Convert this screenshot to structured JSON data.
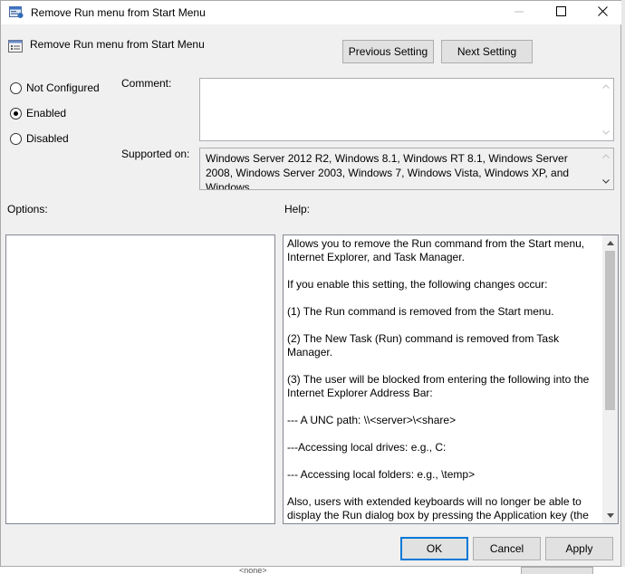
{
  "window": {
    "title": "Remove Run menu from Start Menu"
  },
  "header": {
    "title": "Remove Run menu from Start Menu",
    "prev_label": "Previous Setting",
    "next_label": "Next Setting"
  },
  "state": {
    "options": [
      {
        "label": "Not Configured",
        "selected": false
      },
      {
        "label": "Enabled",
        "selected": true
      },
      {
        "label": "Disabled",
        "selected": false
      }
    ]
  },
  "comment": {
    "label": "Comment:",
    "value": ""
  },
  "supported": {
    "label": "Supported on:",
    "value": "Windows Server 2012 R2, Windows 8.1, Windows RT 8.1, Windows Server 2008, Windows Server 2003, Windows 7, Windows Vista, Windows XP, and Windows"
  },
  "options_panel": {
    "label": "Options:"
  },
  "help": {
    "label": "Help:",
    "paragraphs": [
      "Allows you to remove the Run command from the Start menu, Internet Explorer, and Task Manager.",
      "If you enable this setting, the following changes occur:",
      "(1) The Run command is removed from the Start menu.",
      "(2) The New Task (Run) command is removed from Task Manager.",
      "(3) The user will be blocked from entering the following into the Internet Explorer Address Bar:",
      "--- A UNC path: \\\\<server>\\<share>",
      "---Accessing local drives:  e.g., C:",
      "--- Accessing local folders: e.g., \\temp>",
      "Also, users with extended keyboards will no longer be able to display the Run dialog box by pressing the Application key (the"
    ]
  },
  "footer": {
    "ok_label": "OK",
    "cancel_label": "Cancel",
    "apply_label": "Apply"
  },
  "background": {
    "text": "<none>"
  }
}
